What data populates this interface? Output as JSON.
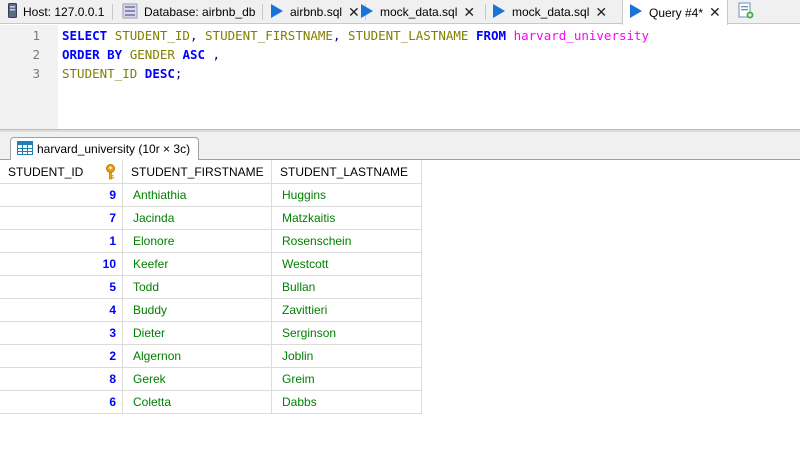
{
  "tabs": [
    {
      "label": "Host: 127.0.0.1",
      "icon": "host-icon",
      "closable": false,
      "active": false
    },
    {
      "label": "Database: airbnb_db",
      "icon": "database-icon",
      "closable": false,
      "active": false
    },
    {
      "label": "airbnb.sql",
      "icon": "query-file-icon",
      "closable": true,
      "active": false
    },
    {
      "label": "mock_data.sql",
      "icon": "query-file-icon",
      "closable": true,
      "active": false
    },
    {
      "label": "mock_data.sql",
      "icon": "query-file-icon",
      "closable": true,
      "active": false
    },
    {
      "label": "Query #4*",
      "icon": "query-file-icon",
      "closable": true,
      "active": true
    }
  ],
  "new_tab_icon": "new-query-tab-icon",
  "editor": {
    "line_numbers": [
      "1",
      "2",
      "3"
    ],
    "tokens": {
      "select": "SELECT",
      "col1": "STUDENT_ID",
      "comma1": ", ",
      "col2": "STUDENT_FIRSTNAME",
      "comma2": ", ",
      "col3": "STUDENT_LASTNAME",
      "from": "FROM",
      "table": "harvard_university",
      "order_by": "ORDER BY",
      "gender": "GENDER",
      "asc": "ASC",
      "comma3": " ,",
      "col1b": "STUDENT_ID",
      "desc": "DESC",
      "semicolon": ";"
    }
  },
  "result_tab": {
    "label": "harvard_university (10r × 3c)",
    "icon": "table-icon"
  },
  "grid": {
    "columns": [
      "STUDENT_ID",
      "STUDENT_FIRSTNAME",
      "STUDENT_LASTNAME"
    ],
    "primary_key_icon": "primary-key-icon",
    "rows": [
      [
        "9",
        "Anthiathia",
        "Huggins"
      ],
      [
        "7",
        "Jacinda",
        "Matzkaitis"
      ],
      [
        "1",
        "Elonore",
        "Rosenschein"
      ],
      [
        "10",
        "Keefer",
        "Westcott"
      ],
      [
        "5",
        "Todd",
        "Bullan"
      ],
      [
        "4",
        "Buddy",
        "Zavittieri"
      ],
      [
        "3",
        "Dieter",
        "Serginson"
      ],
      [
        "2",
        "Algernon",
        "Joblin"
      ],
      [
        "8",
        "Gerek",
        "Greim"
      ],
      [
        "6",
        "Coletta",
        "Dabbs"
      ]
    ]
  },
  "colors": {
    "keyword": "#0000ff",
    "identifier": "#808000",
    "table_name": "#ff00ff",
    "numeric_value": "#0000ff",
    "text_value": "#008000",
    "tab_icon_blue": "#1a73d9",
    "key_icon": "#e8a317"
  }
}
